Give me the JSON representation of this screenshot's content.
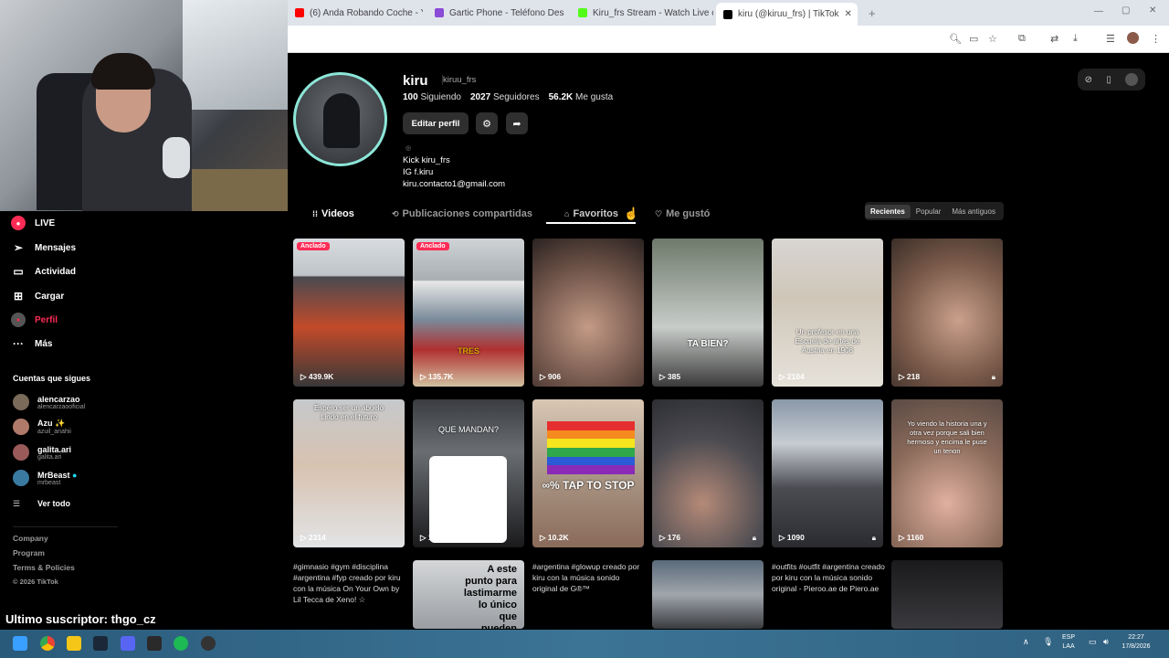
{
  "browser": {
    "tabs": [
      {
        "title": "(6) Anda Robando Coche - YouT",
        "color": "#ff0000"
      },
      {
        "title": "Gartic Phone - Teléfono Descon",
        "color": "#8a4bd6"
      },
      {
        "title": "Kiru_frs Stream - Watch Live on",
        "color": "#53fc18"
      },
      {
        "title": "kiru (@kiruu_frs) | TikTok",
        "color": "#000000"
      }
    ],
    "new_tab": "+"
  },
  "sidebar": {
    "nav": [
      {
        "label": "LIVE"
      },
      {
        "label": "Mensajes"
      },
      {
        "label": "Actividad"
      },
      {
        "label": "Cargar"
      },
      {
        "label": "Perfil"
      },
      {
        "label": "Más"
      }
    ],
    "following_title": "Cuentas que sigues",
    "following": [
      {
        "name": "alencarzao",
        "handle": "alencarzaooficial"
      },
      {
        "name": "Azu ✨",
        "handle": "azuil_anahii"
      },
      {
        "name": "galita.ari",
        "handle": "galita.ari"
      },
      {
        "name": "MrBeast",
        "handle": "mrbeast"
      }
    ],
    "see_all": "Ver todo",
    "footer": [
      "Company",
      "Program",
      "Terms & Policies",
      "© 2026 TikTok"
    ]
  },
  "profile": {
    "name": "kiru",
    "handle": "kiruu_frs",
    "following_count": "100",
    "following_label": "Siguiendo",
    "followers_count": "2027",
    "followers_label": "Seguidores",
    "likes_count": "56.2K",
    "likes_label": "Me gusta",
    "edit_button": "Editar perfil",
    "bio": [
      "Kick kiru_frs",
      "IG f.kiru",
      "kiru.contacto1@gmail.com"
    ]
  },
  "tabs": [
    "Videos",
    "Publicaciones compartidas",
    "Favoritos",
    "Me gustó"
  ],
  "sort": [
    "Recientes",
    "Popular",
    "Más antiguos"
  ],
  "videos": [
    {
      "views": "439.9K",
      "badge": "Anclado",
      "caption": ""
    },
    {
      "views": "135.7K",
      "badge": "Anclado",
      "caption": "TRES"
    },
    {
      "views": "906",
      "badge": "",
      "caption": ""
    },
    {
      "views": "385",
      "badge": "",
      "caption": "TA BIEN?"
    },
    {
      "views": "2104",
      "badge": "",
      "caption": "Un profesor en una Escuela de artes de Austria en 1908"
    },
    {
      "views": "218",
      "badge": "",
      "caption": ""
    },
    {
      "views": "2314",
      "badge": "",
      "caption": "Espero ser un abuelo Lindo en el futuro"
    },
    {
      "views": "1314",
      "badge": "",
      "caption": "QUE MANDAN?"
    },
    {
      "views": "10.2K",
      "badge": "",
      "caption": "∞%  TAP TO STOP"
    },
    {
      "views": "176",
      "badge": "",
      "caption": ""
    },
    {
      "views": "1090",
      "badge": "",
      "caption": ""
    },
    {
      "views": "1160",
      "badge": "",
      "caption": "Yo viendo la historia una y otra vez porque sali bien hermoso y encima le puse un tenon"
    }
  ],
  "row3": [
    {
      "text": "#gimnasio #gym #disciplina #argentina #fyp creado por kiru con la música On Your Own by Lil Tecca de Xeno! ☆"
    },
    {
      "text": "A este punto para lastimarme lo único que pueden"
    },
    {
      "text": "#argentina #glowup creado por kiru con la música sonido original de G®™"
    },
    {
      "text": ""
    },
    {
      "text": "#outfits #outfit #argentina creado por kiru con la música sonido original - Pieroo.ae de Piero.ae"
    },
    {
      "text": ""
    }
  ],
  "stream": {
    "subscriber": "Ultimo suscriptor: thgo_cz"
  },
  "taskbar": {
    "lang": "ESP",
    "lang2": "LAA",
    "time": "22:27",
    "date": "17/8/2026"
  }
}
